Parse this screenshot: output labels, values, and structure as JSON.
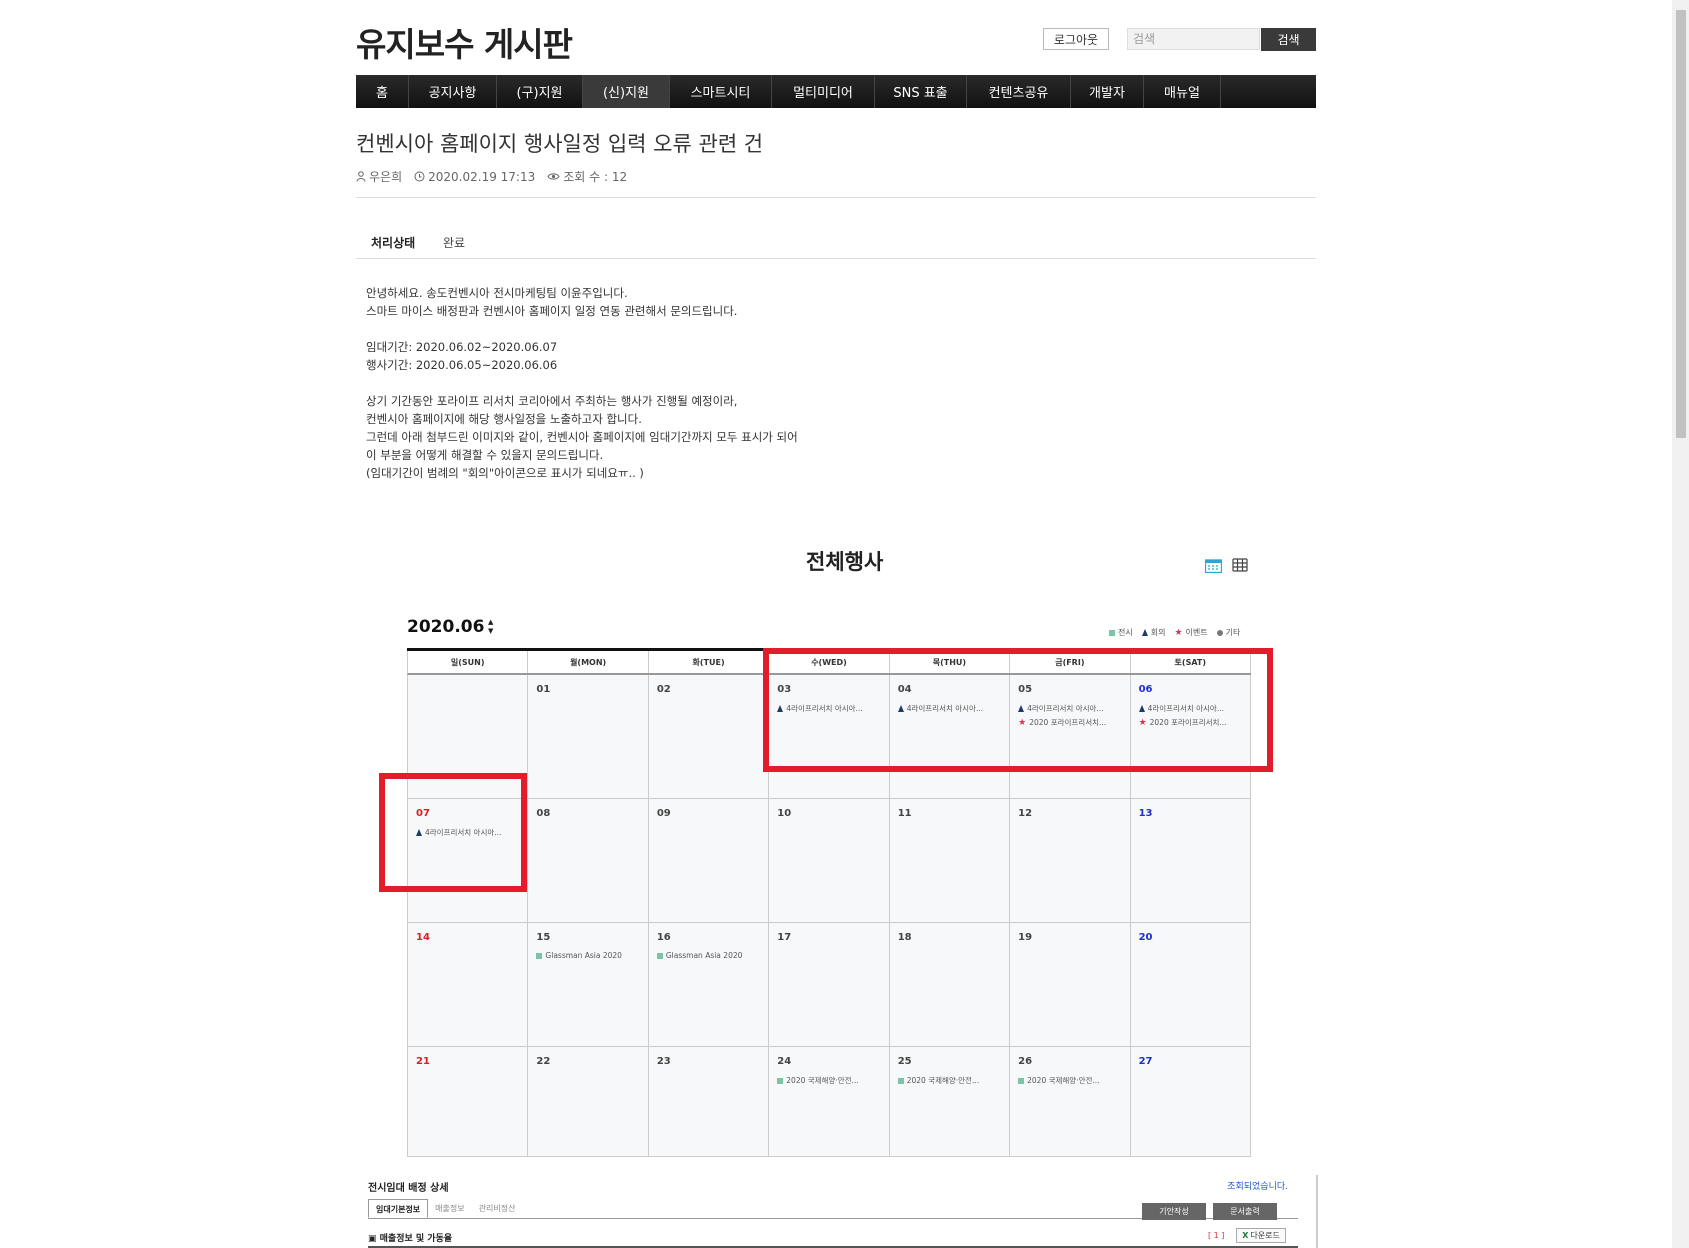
{
  "header": {
    "site_title": "유지보수 게시판",
    "logout_label": "로그아웃",
    "search_placeholder": "검색",
    "search_button": "검색"
  },
  "nav": [
    {
      "label": "홈"
    },
    {
      "label": "공지사항"
    },
    {
      "label": "(구)지원"
    },
    {
      "label": "(신)지원",
      "active": true
    },
    {
      "label": "스마트시티"
    },
    {
      "label": "멀티미디어"
    },
    {
      "label": "SNS 표출"
    },
    {
      "label": "컨텐츠공유"
    },
    {
      "label": "개발자"
    },
    {
      "label": "매뉴얼"
    }
  ],
  "post": {
    "title": "컨벤시아 홈페이지 행사일정 입력 오류 관련 건",
    "author": "우은희",
    "datetime": "2020.02.19 17:13",
    "views": "조회 수 : 12",
    "status_label": "처리상태",
    "status_value": "완료",
    "body_lines": [
      "안녕하세요. 송도컨벤시아 전시마케팅팀 이윤주입니다.",
      "스마트 마이스 배정판과 컨벤시아 홈페이지 일정 연동 관련해서 문의드립니다.",
      "",
      "임대기간: 2020.06.02~2020.06.07",
      "행사기간: 2020.06.05~2020.06.06",
      "",
      "상기 기간동안 포라이프 리서치 코리아에서 주최하는 행사가 진행될 예정이라,",
      "컨벤시아 홈페이지에 해당 행사일정을 노출하고자 합니다.",
      "그런데 아래 첨부드린 이미지와 같이, 컨벤시아 홈페이지에 임대기간까지 모두 표시가 되어",
      "이 부분을 어떻게 해결할 수 있을지 문의드립니다.",
      "(임대기간이 범례의 \"회의\"아이콘으로 표시가 되네요ㅠ.. )"
    ]
  },
  "calendar": {
    "title": "전체행사",
    "year_month": "2020.06",
    "legend": [
      {
        "label": "전시",
        "icon": "square",
        "color": "#7cc4a6"
      },
      {
        "label": "회의",
        "icon": "triangle",
        "color": "#1e3a66"
      },
      {
        "label": "이벤트",
        "icon": "star",
        "color": "#e0334f"
      },
      {
        "label": "기타",
        "icon": "dot",
        "color": "#777777"
      }
    ],
    "weekdays": [
      "일(SUN)",
      "월(MON)",
      "화(TUE)",
      "수(WED)",
      "목(THU)",
      "금(FRI)",
      "토(SAT)"
    ],
    "cells": [
      {
        "d": "",
        "events": []
      },
      {
        "d": "01",
        "events": []
      },
      {
        "d": "02",
        "events": []
      },
      {
        "d": "03",
        "events": [
          {
            "t": "tri",
            "text": "4라이프리서치 아시아..."
          }
        ]
      },
      {
        "d": "04",
        "events": [
          {
            "t": "tri",
            "text": "4라이프리서치 아시아..."
          }
        ]
      },
      {
        "d": "05",
        "events": [
          {
            "t": "tri",
            "text": "4라이프리서치 아시아..."
          },
          {
            "t": "star",
            "text": "2020 포라이프리서치..."
          }
        ]
      },
      {
        "d": "06",
        "events": [
          {
            "t": "tri",
            "text": "4라이프리서치 아시아..."
          },
          {
            "t": "star",
            "text": "2020 포라이프리서치..."
          }
        ]
      },
      {
        "d": "07",
        "events": [
          {
            "t": "tri",
            "text": "4라이프리서치 아시아..."
          }
        ]
      },
      {
        "d": "08",
        "events": []
      },
      {
        "d": "09",
        "events": []
      },
      {
        "d": "10",
        "events": []
      },
      {
        "d": "11",
        "events": []
      },
      {
        "d": "12",
        "events": []
      },
      {
        "d": "13",
        "events": []
      },
      {
        "d": "14",
        "events": []
      },
      {
        "d": "15",
        "events": [
          {
            "t": "sq",
            "text": "Glassman Asia 2020"
          }
        ]
      },
      {
        "d": "16",
        "events": [
          {
            "t": "sq",
            "text": "Glassman Asia 2020"
          }
        ]
      },
      {
        "d": "17",
        "events": []
      },
      {
        "d": "18",
        "events": []
      },
      {
        "d": "19",
        "events": []
      },
      {
        "d": "20",
        "events": []
      },
      {
        "d": "21",
        "events": []
      },
      {
        "d": "22",
        "events": []
      },
      {
        "d": "23",
        "events": []
      },
      {
        "d": "24",
        "events": [
          {
            "t": "sq",
            "text": "2020 국제해양·안전..."
          }
        ]
      },
      {
        "d": "25",
        "events": [
          {
            "t": "sq",
            "text": "2020 국제해양·안전..."
          }
        ]
      },
      {
        "d": "26",
        "events": [
          {
            "t": "sq",
            "text": "2020 국제해양·안전..."
          }
        ]
      },
      {
        "d": "27",
        "events": []
      }
    ]
  },
  "detail": {
    "title": "전시임대 배정 상세",
    "note": "조회되었습니다.",
    "tabs": [
      "임대기본정보",
      "매출정보",
      "관리비정산"
    ],
    "btn_write": "기안작성",
    "btn_print": "문서출력",
    "subtitle": "매출정보 및 가동율",
    "count": "[ 1 ]",
    "download": "다운로드"
  }
}
